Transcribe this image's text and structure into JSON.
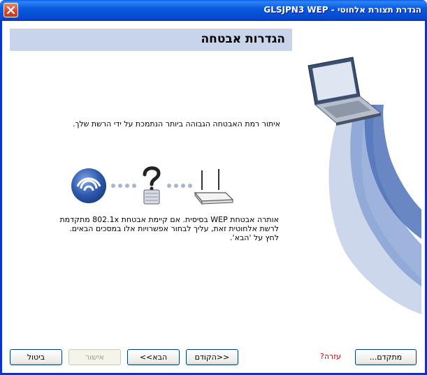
{
  "window": {
    "title": "הגדרת תצורת אלחוטי - GLSJPN3 WEP"
  },
  "page": {
    "title": "הגדרות אבטחה",
    "intro": "איתור רמת האבטחה הגבוהה ביותר הנתמכת על ידי הרשת שלך.",
    "description_lines": [
      "אותרה אבטחת WEP בסיסית. אם קיימת אבטחת 802.1x מתקדמת",
      "לרשת אלחוטית זאת, עליך לבחור אפשרויות אלו במסכים הבאים.",
      "לחץ על 'הבא'."
    ]
  },
  "buttons": {
    "advanced": "מתקדם...",
    "help": "עזרה?",
    "back": "<<הקודם",
    "next": "הבא>>",
    "ok": "אישור",
    "cancel": "ביטול"
  },
  "colors": {
    "titlebar": "#0a5ae0",
    "header_band": "#c7d4e9",
    "help_link": "#b40000",
    "accent_blue": "#3e6cb8"
  }
}
